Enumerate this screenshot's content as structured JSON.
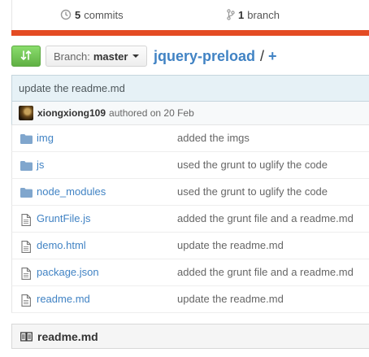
{
  "summary": {
    "commits_count": "5",
    "commits_label": "commits",
    "branch_count": "1",
    "branch_label": "branch"
  },
  "language_bar_color": "#e44b23",
  "branch_selector": {
    "label": "Branch:",
    "value": "master"
  },
  "breadcrumb": {
    "repo": "jquery-preload",
    "separator": "/",
    "add": "+"
  },
  "commit": {
    "title": "update the readme.md",
    "author": "xiongxiong109",
    "authored": "authored on 20 Feb"
  },
  "files": [
    {
      "type": "folder",
      "icon": "folder-icon",
      "name": "img",
      "message": "added the imgs"
    },
    {
      "type": "folder",
      "icon": "folder-icon",
      "name": "js",
      "message": "used the grunt to uglify the code"
    },
    {
      "type": "folder",
      "icon": "folder-icon",
      "name": "node_modules",
      "message": "used the grunt to uglify the code"
    },
    {
      "type": "file",
      "icon": "file-icon",
      "name": "GruntFile.js",
      "message": "added the grunt file and a readme.md"
    },
    {
      "type": "file",
      "icon": "file-icon",
      "name": "demo.html",
      "message": "update the readme.md"
    },
    {
      "type": "file",
      "icon": "file-icon",
      "name": "package.json",
      "message": "added the grunt file and a readme.md"
    },
    {
      "type": "file",
      "icon": "file-icon",
      "name": "readme.md",
      "message": "update the readme.md"
    }
  ],
  "readme": {
    "title": "readme.md"
  }
}
